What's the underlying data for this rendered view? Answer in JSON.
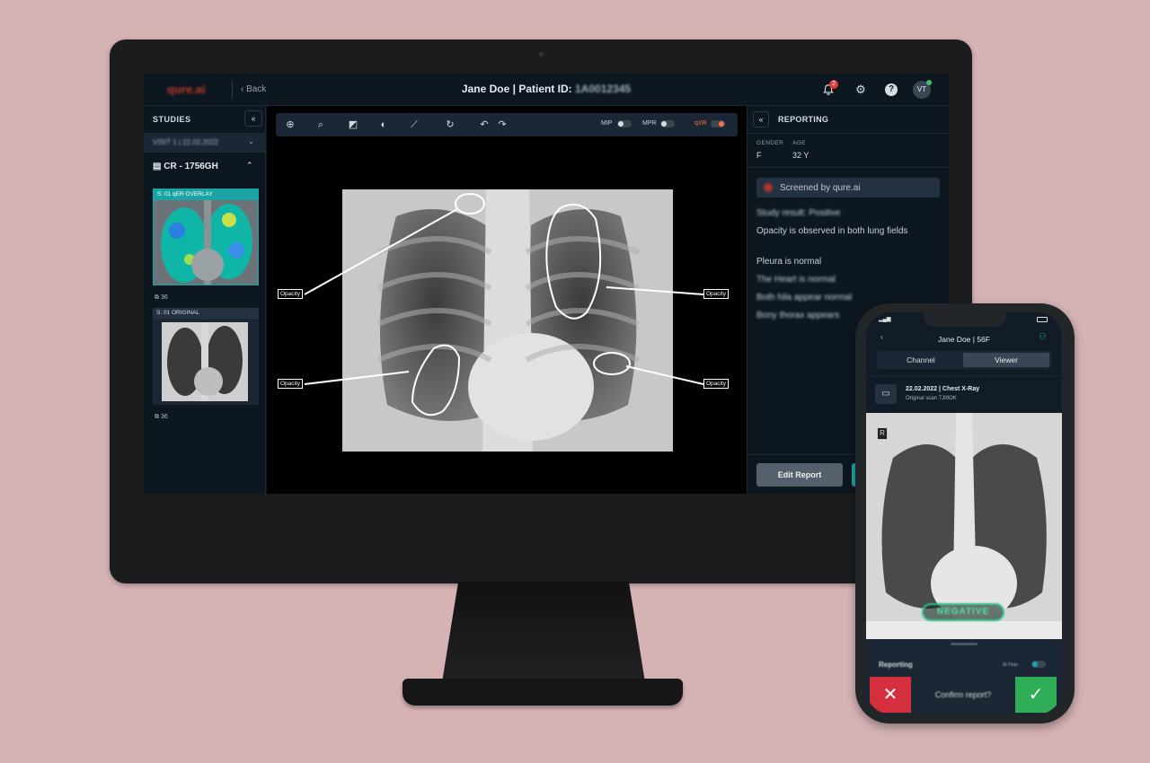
{
  "app": {
    "logo_text": "qure.ai",
    "back_label": "Back",
    "patient_name": "Jane Doe",
    "patient_prefix": "Patient ID:",
    "patient_id": "1A0012345",
    "notification_count": "2",
    "avatar_initials": "VT"
  },
  "studies": {
    "title": "STUDIES",
    "visit_label": "VISIT 1 | 22.02.2022",
    "study_label": "CR - 1756GH",
    "series": [
      {
        "label": "S: 01   qER OVERLAY",
        "count": "36"
      },
      {
        "label": "S: 01   ORIGINAL",
        "count": "36"
      }
    ]
  },
  "viewer": {
    "toggles": {
      "mip": "MIP",
      "mpr": "MPR",
      "qxr": "qXR"
    },
    "annotations": [
      "Opacity",
      "Opacity",
      "Opacity",
      "Opacity"
    ]
  },
  "reporting": {
    "title": "REPORTING",
    "gender_label": "GENDER",
    "gender_value": "F",
    "age_label": "AGE",
    "age_value": "32 Y",
    "screened_by": "Screened by qure.ai",
    "findings": [
      "Study result: Positive",
      "Opacity is observed in both lung fields",
      "Pleura is normal",
      "The Heart is normal",
      "Both hila appear normal",
      "Bony thorax appears"
    ],
    "edit_report_label": "Edit Report"
  },
  "phone": {
    "title": "Jane Doe | 56F",
    "tabs": [
      "Channel",
      "Viewer"
    ],
    "active_tab": "Viewer",
    "scan_title": "22.02.2022 | Chest X-Ray",
    "scan_subtitle": "Original scan 7JI9OK",
    "orientation_marker": "R",
    "result_badge": "NEGATIVE",
    "bottom_title": "Reporting",
    "toggle_label": "AI Flow",
    "confirm_text": "Confirm report?"
  },
  "colors": {
    "accent_teal": "#1aa5a4",
    "alert_red": "#d42f3c",
    "success_green": "#2fae57",
    "qxr_orange": "#ff6d4a",
    "background": "#d5b2b4"
  }
}
